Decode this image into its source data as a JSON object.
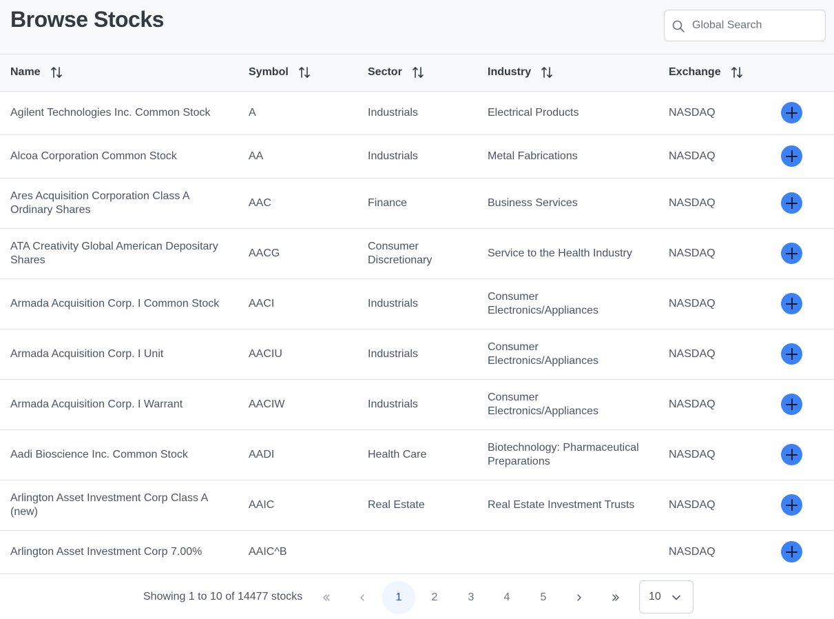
{
  "header": {
    "title": "Browse Stocks",
    "search_placeholder": "Global Search"
  },
  "table": {
    "columns": [
      "Name",
      "Symbol",
      "Sector",
      "Industry",
      "Exchange"
    ],
    "rows": [
      {
        "name": "Agilent Technologies Inc. Common Stock",
        "symbol": "A",
        "sector": "Industrials",
        "industry": "Electrical Products",
        "exchange": "NASDAQ"
      },
      {
        "name": "Alcoa Corporation Common Stock",
        "symbol": "AA",
        "sector": "Industrials",
        "industry": "Metal Fabrications",
        "exchange": "NASDAQ"
      },
      {
        "name": "Ares Acquisition Corporation Class A Ordinary Shares",
        "symbol": "AAC",
        "sector": "Finance",
        "industry": "Business Services",
        "exchange": "NASDAQ"
      },
      {
        "name": "ATA Creativity Global American Depositary Shares",
        "symbol": "AACG",
        "sector": "Consumer Discretionary",
        "industry": "Service to the Health Industry",
        "exchange": "NASDAQ"
      },
      {
        "name": "Armada Acquisition Corp. I Common Stock",
        "symbol": "AACI",
        "sector": "Industrials",
        "industry": "Consumer Electronics/Appliances",
        "exchange": "NASDAQ"
      },
      {
        "name": "Armada Acquisition Corp. I Unit",
        "symbol": "AACIU",
        "sector": "Industrials",
        "industry": "Consumer Electronics/Appliances",
        "exchange": "NASDAQ"
      },
      {
        "name": "Armada Acquisition Corp. I Warrant",
        "symbol": "AACIW",
        "sector": "Industrials",
        "industry": "Consumer Electronics/Appliances",
        "exchange": "NASDAQ"
      },
      {
        "name": "Aadi Bioscience Inc. Common Stock",
        "symbol": "AADI",
        "sector": "Health Care",
        "industry": "Biotechnology: Pharmaceutical Preparations",
        "exchange": "NASDAQ"
      },
      {
        "name": "Arlington Asset Investment Corp Class A (new)",
        "symbol": "AAIC",
        "sector": "Real Estate",
        "industry": "Real Estate Investment Trusts",
        "exchange": "NASDAQ"
      },
      {
        "name": "Arlington Asset Investment Corp 7.00%",
        "symbol": "AAIC^B",
        "sector": "",
        "industry": "",
        "exchange": "NASDAQ"
      }
    ]
  },
  "pagination": {
    "showing_text": "Showing 1 to 10 of 14477 stocks",
    "pages": [
      "1",
      "2",
      "3",
      "4",
      "5"
    ],
    "current_page": "1",
    "rows_per_page": "10"
  },
  "colors": {
    "accent": "#3b82f6",
    "active_page_bg": "#eff6ff",
    "header_bg": "#f8f9fa"
  },
  "icons": [
    "search-icon",
    "sort-icon",
    "plus-icon",
    "first-page-icon",
    "prev-page-icon",
    "next-page-icon",
    "last-page-icon",
    "chevron-down-icon"
  ]
}
